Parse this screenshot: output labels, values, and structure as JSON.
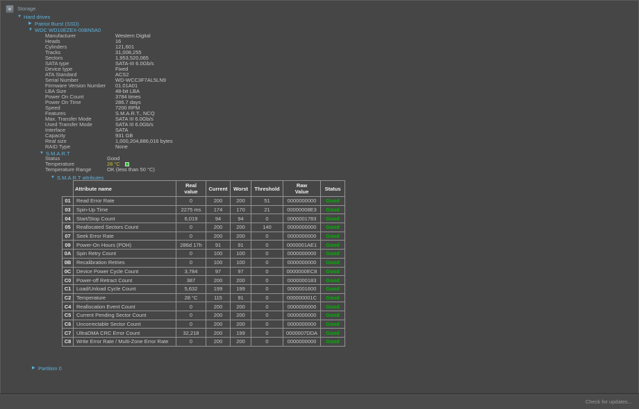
{
  "colors": {
    "tree_accent": "#5db2dc",
    "root_label": "#92a6b3",
    "good_green": "#00b400",
    "temperature_yellow": "#c2c22a",
    "background": "#464646"
  },
  "tree": {
    "root": {
      "label": "Storage"
    },
    "hard_drives": {
      "arrow": "▼",
      "label": "Hard drives"
    },
    "patriot": {
      "arrow": "▶",
      "label": "Patriot Burst (SSD)"
    },
    "wdc": {
      "arrow": "▼",
      "label": "WDC WD10EZEX-00BN5A0"
    },
    "smart": {
      "arrow": "▼",
      "label": "S.M.A.R.T"
    },
    "smart_attributes": {
      "arrow": "▼",
      "label": "S.M.A.R.T attributes"
    },
    "partition": {
      "arrow": "▶",
      "label": "Partition 0"
    }
  },
  "drive_details": [
    {
      "label": "Manufacturer",
      "value": "Western Digital"
    },
    {
      "label": "Heads",
      "value": "16"
    },
    {
      "label": "Cylinders",
      "value": "121,601"
    },
    {
      "label": "Tracks",
      "value": "31,008,255"
    },
    {
      "label": "Sectors",
      "value": "1,953,520,065"
    },
    {
      "label": "SATA type",
      "value": "SATA-III 6.0Gb/s"
    },
    {
      "label": "Device type",
      "value": "Fixed"
    },
    {
      "label": "ATA Standard",
      "value": "ACS2"
    },
    {
      "label": "Serial Number",
      "value": "WD-WCC3F7AL5LN9"
    },
    {
      "label": "Firmware Version Number",
      "value": "01.01A01"
    },
    {
      "label": "LBA Size",
      "value": "48-bit LBA"
    },
    {
      "label": "Power On Count",
      "value": "3784 times"
    },
    {
      "label": "Power On Time",
      "value": "286.7 days"
    },
    {
      "label": "Speed",
      "value": "7200 RPM"
    },
    {
      "label": "Features",
      "value": "S.M.A.R.T., NCQ"
    },
    {
      "label": "Max. Transfer Mode",
      "value": "SATA III 6.0Gb/s"
    },
    {
      "label": "Used Transfer Mode",
      "value": "SATA III 6.0Gb/s"
    },
    {
      "label": "Interface",
      "value": "SATA"
    },
    {
      "label": "Capacity",
      "value": "931 GB"
    },
    {
      "label": "Real size",
      "value": "1,000,204,886,016 bytes"
    },
    {
      "label": "RAID Type",
      "value": "None"
    }
  ],
  "smart_info": {
    "status": {
      "label": "Status",
      "value": "Good"
    },
    "temperature": {
      "label": "Temperature",
      "value": "28 °C"
    },
    "temp_range": {
      "label": "Temperature Range",
      "value": "OK (less than 50 °C)"
    }
  },
  "smart_table": {
    "headers": {
      "name": "Attribute name",
      "real": "Real value",
      "current": "Current",
      "worst": "Worst",
      "threshold": "Threshold",
      "raw": "Raw Value",
      "status": "Status"
    },
    "rows": [
      {
        "id": "01",
        "name": "Read Error Rate",
        "real": "0",
        "current": "200",
        "worst": "200",
        "threshold": "51",
        "raw": "0000000000",
        "status": "Good"
      },
      {
        "id": "03",
        "name": "Spin-Up Time",
        "real": "2275 ms",
        "current": "174",
        "worst": "170",
        "threshold": "21",
        "raw": "00000008E3",
        "status": "Good"
      },
      {
        "id": "04",
        "name": "Start/Stop Count",
        "real": "6,019",
        "current": "94",
        "worst": "94",
        "threshold": "0",
        "raw": "0000001783",
        "status": "Good"
      },
      {
        "id": "05",
        "name": "Reallocated Sectors Count",
        "real": "0",
        "current": "200",
        "worst": "200",
        "threshold": "140",
        "raw": "0000000000",
        "status": "Good"
      },
      {
        "id": "07",
        "name": "Seek Error Rate",
        "real": "0",
        "current": "200",
        "worst": "200",
        "threshold": "0",
        "raw": "0000000000",
        "status": "Good"
      },
      {
        "id": "09",
        "name": "Power-On Hours (POH)",
        "real": "286d 17h",
        "current": "91",
        "worst": "91",
        "threshold": "0",
        "raw": "0000001AE1",
        "status": "Good"
      },
      {
        "id": "0A",
        "name": "Spin Retry Count",
        "real": "0",
        "current": "100",
        "worst": "100",
        "threshold": "0",
        "raw": "0000000000",
        "status": "Good"
      },
      {
        "id": "0B",
        "name": "Recalibration Retries",
        "real": "0",
        "current": "100",
        "worst": "100",
        "threshold": "0",
        "raw": "0000000000",
        "status": "Good"
      },
      {
        "id": "0C",
        "name": "Device Power Cycle Count",
        "real": "3,784",
        "current": "97",
        "worst": "97",
        "threshold": "0",
        "raw": "0000000EC8",
        "status": "Good"
      },
      {
        "id": "C0",
        "name": "Power-off Retract Count",
        "real": "387",
        "current": "200",
        "worst": "200",
        "threshold": "0",
        "raw": "0000000183",
        "status": "Good"
      },
      {
        "id": "C1",
        "name": "Load/Unload Cycle Count",
        "real": "5,632",
        "current": "199",
        "worst": "199",
        "threshold": "0",
        "raw": "0000001600",
        "status": "Good"
      },
      {
        "id": "C2",
        "name": "Temperature",
        "real": "28 °C",
        "current": "115",
        "worst": "91",
        "threshold": "0",
        "raw": "000000001C",
        "status": "Good"
      },
      {
        "id": "C4",
        "name": "Reallocation Event Count",
        "real": "0",
        "current": "200",
        "worst": "200",
        "threshold": "0",
        "raw": "0000000000",
        "status": "Good"
      },
      {
        "id": "C5",
        "name": "Current Pending Sector Count",
        "real": "0",
        "current": "200",
        "worst": "200",
        "threshold": "0",
        "raw": "0000000000",
        "status": "Good"
      },
      {
        "id": "C6",
        "name": "Uncorrectable Sector Count",
        "real": "0",
        "current": "200",
        "worst": "200",
        "threshold": "0",
        "raw": "0000000000",
        "status": "Good"
      },
      {
        "id": "C7",
        "name": "UltraDMA CRC Error Count",
        "real": "32,218",
        "current": "200",
        "worst": "199",
        "threshold": "0",
        "raw": "0000007DDA",
        "status": "Good"
      },
      {
        "id": "C8",
        "name": "Write Error Rate / Multi-Zone Error Rate",
        "real": "0",
        "current": "200",
        "worst": "200",
        "threshold": "0",
        "raw": "0000000000",
        "status": "Good"
      }
    ]
  },
  "statusbar": {
    "update_link": "Check for updates..."
  }
}
